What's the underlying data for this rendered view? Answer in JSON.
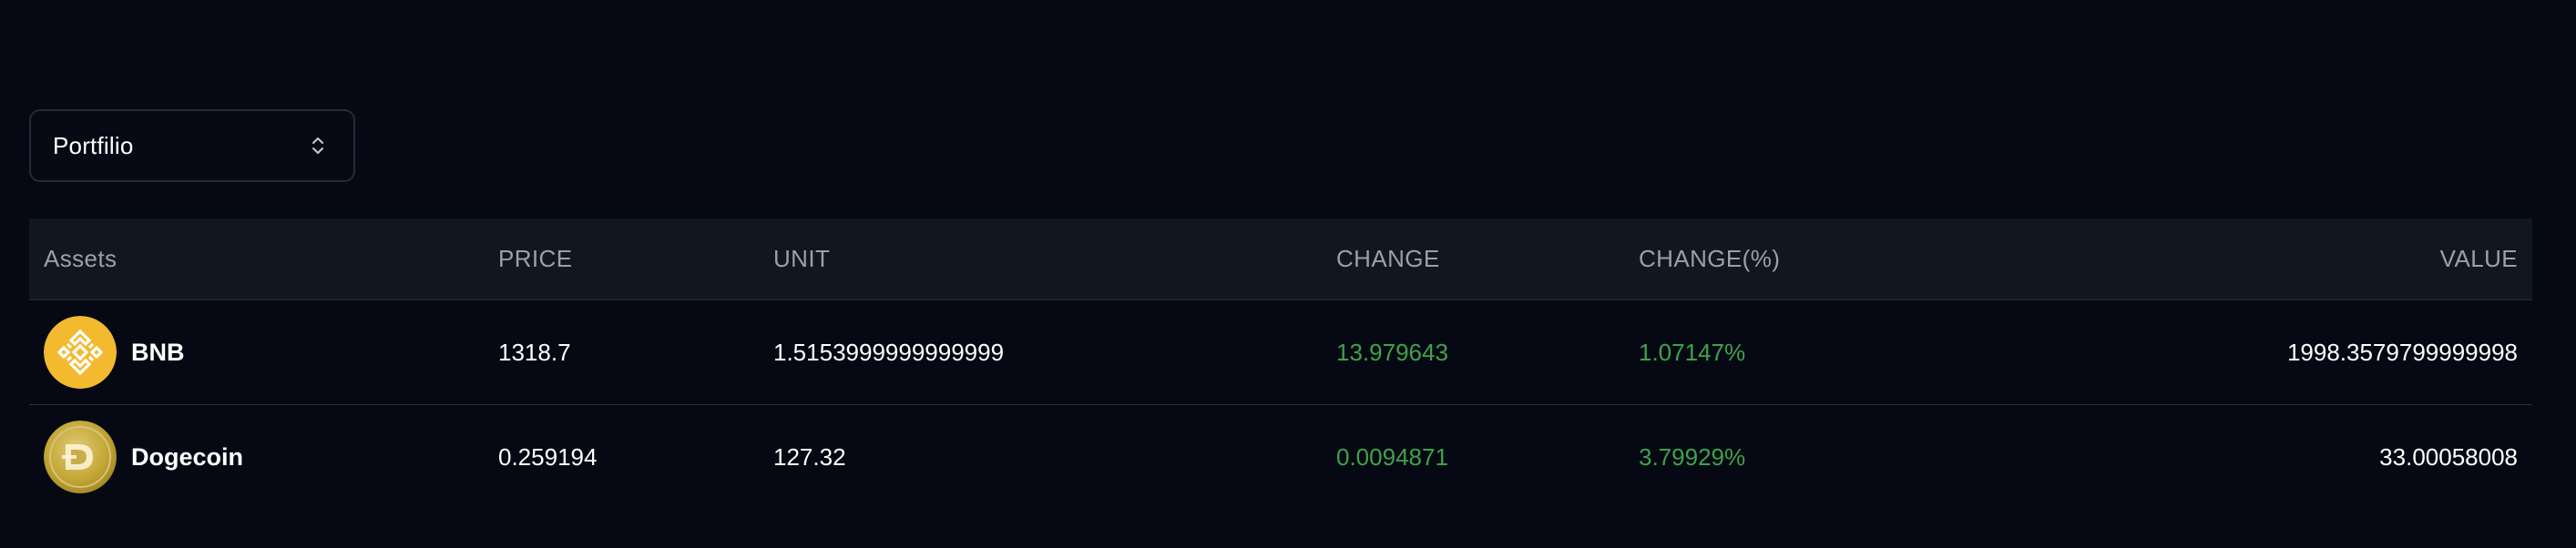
{
  "portfolio_select": {
    "selected": "Portfilio",
    "caret_icon": "chevron-up-down-icon"
  },
  "table": {
    "headers": {
      "assets": "Assets",
      "price": "PRICE",
      "unit": "UNIT",
      "change": "CHANGE",
      "change_pct": "CHANGE(%)",
      "value": "VALUE"
    },
    "rows": [
      {
        "icon": "bnb-logo-icon",
        "name": "BNB",
        "price": "1318.7",
        "unit": "1.5153999999999999",
        "change": "13.979643",
        "change_pct": "1.07147%",
        "value": "1998.3579799999998"
      },
      {
        "icon": "dogecoin-logo-icon",
        "name": "Dogecoin",
        "price": "0.259194",
        "unit": "127.32",
        "change": "0.0094871",
        "change_pct": "3.79929%",
        "value": "33.00058008"
      }
    ]
  },
  "colors": {
    "background": "#060913",
    "header_background": "#101721",
    "positive": "#3fa24a",
    "bnb": "#f3ba2f",
    "dogecoin": "#c2a633"
  }
}
